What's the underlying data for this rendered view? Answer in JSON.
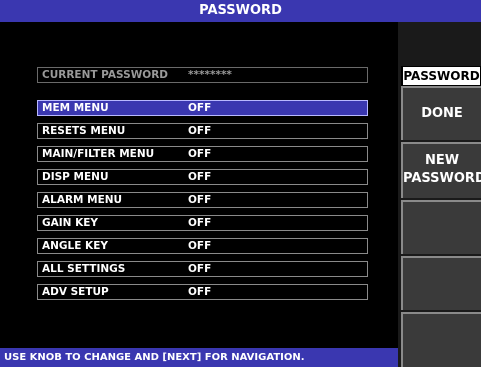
{
  "title": "PASSWORD",
  "current_password": {
    "label": "CURRENT PASSWORD",
    "value": "********"
  },
  "menu_rows": [
    {
      "label": "MEM MENU",
      "value": "OFF"
    },
    {
      "label": "RESETS MENU",
      "value": "OFF"
    },
    {
      "label": "MAIN/FILTER MENU",
      "value": "OFF"
    },
    {
      "label": "DISP MENU",
      "value": "OFF"
    },
    {
      "label": "ALARM MENU",
      "value": "OFF"
    },
    {
      "label": "GAIN KEY",
      "value": "OFF"
    },
    {
      "label": "ANGLE KEY",
      "value": "OFF"
    },
    {
      "label": "ALL SETTINGS",
      "value": "OFF"
    },
    {
      "label": "ADV SETUP",
      "value": "OFF"
    }
  ],
  "sidebar": {
    "header": "PASSWORD",
    "buttons": [
      "DONE",
      "NEW PASSWORD",
      "",
      "",
      ""
    ]
  },
  "status_text": "USE KNOB TO CHANGE AND [NEXT] FOR NAVIGATION.",
  "colors": {
    "title_bar": "#3a37b0",
    "selected_row": "#3a37b0",
    "background": "#000000"
  }
}
